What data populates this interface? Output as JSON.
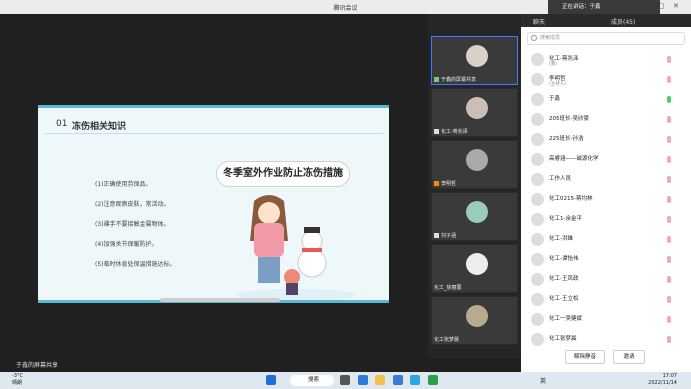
{
  "app": {
    "title": "腾讯会议"
  },
  "speaking": {
    "label": "正在讲话：于鑫"
  },
  "slide": {
    "number": "01",
    "heading": "冻伤相关知识",
    "title": "冬季室外作业防止冻伤措施",
    "items": [
      "(1)正确使用劳保品。",
      "(2)注意观察皮肤，常活动。",
      "(3)裸手不要接触金属物体。",
      "(4)加强关节保暖防护。",
      "(5)临时休息处保温措施达标。"
    ]
  },
  "tiles": [
    {
      "label": "于鑫的屏幕共享"
    },
    {
      "label": "化工-蒋兆泽"
    },
    {
      "label": "李明哲"
    },
    {
      "label": "刘子涵"
    },
    {
      "label": "化工_徐丽蓉"
    },
    {
      "label": "化工张梦晨"
    }
  ],
  "chat": {
    "tab_chat": "聊天",
    "tab_members": "成员(45)",
    "search_placeholder": "搜索成员",
    "members": [
      {
        "name": "化工-蒋兆泽",
        "sub": "(我)"
      },
      {
        "name": "李明哲",
        "sub": "(主持人)"
      },
      {
        "name": "于鑫",
        "sub": ""
      },
      {
        "name": "205班长-吴欣豪",
        "sub": ""
      },
      {
        "name": "225班长-孙浩",
        "sub": ""
      },
      {
        "name": "高睿涵——磁源化学",
        "sub": ""
      },
      {
        "name": "工作人员",
        "sub": ""
      },
      {
        "name": "化工0215-蒋均林",
        "sub": ""
      },
      {
        "name": "化工1-余金平",
        "sub": ""
      },
      {
        "name": "化工-洪雄",
        "sub": ""
      },
      {
        "name": "化工-谭怡伟",
        "sub": ""
      },
      {
        "name": "化工-王凤政",
        "sub": ""
      },
      {
        "name": "化工-王立松",
        "sub": ""
      },
      {
        "name": "化工一吴健斌",
        "sub": ""
      },
      {
        "name": "化工张梦晨",
        "sub": ""
      }
    ],
    "btn_unmute_all": "解除静音",
    "btn_invite": "邀请"
  },
  "share_bar": {
    "label": "于鑫的屏幕共享"
  },
  "taskbar": {
    "temp": "-3°C",
    "weather": "晴朗",
    "search": "搜索",
    "ime": "英",
    "time": "17:07",
    "date": "2022/11/14"
  }
}
